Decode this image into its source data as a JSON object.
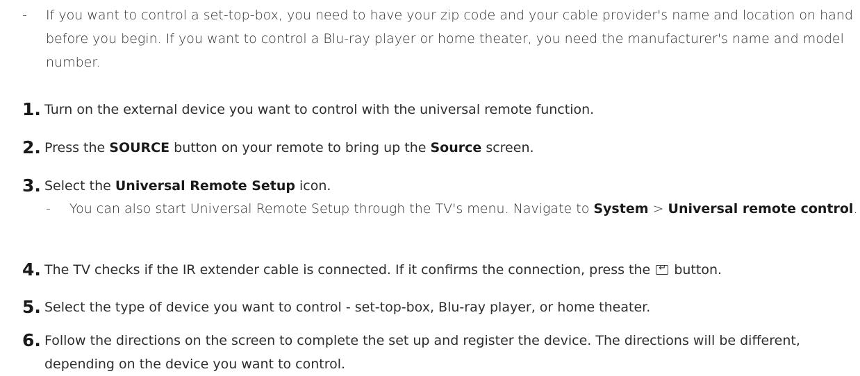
{
  "intro_note": {
    "dash": "-",
    "text": "If you want to control a set-top-box, you need to have your zip code and your cable provider's name and location on hand before you begin. If you want to control a Blu-ray player or home theater, you need the manufacturer's name and model number."
  },
  "steps": [
    {
      "number": "1.",
      "text": "Turn on the external device you want to control with the universal remote function."
    },
    {
      "number": "2.",
      "before": "Press the ",
      "bold1": "SOURCE",
      "middle": " button on your remote to bring up the ",
      "bold2": "Source",
      "after": " screen."
    },
    {
      "number": "3.",
      "before": "Select the ",
      "bold1": "Universal Remote Setup",
      "after": " icon.",
      "note": {
        "dash": "-",
        "before": "You can also start Universal Remote Setup through the TV's menu. Navigate to ",
        "bold1": "System",
        "separator": " > ",
        "bold2": "Universal remote control",
        "after": "."
      }
    },
    {
      "number": "4.",
      "before": "The TV checks if the IR extender cable is connected. If it confirms the connection, press the ",
      "icon": "enter-icon",
      "after": " button."
    },
    {
      "number": "5.",
      "text": "Select the type of device you want to control - set-top-box, Blu-ray player, or home theater."
    },
    {
      "number": "6.",
      "text": "Follow the directions on the screen to complete the set up and register the device. The directions will be different, depending on the device you want to control."
    }
  ]
}
